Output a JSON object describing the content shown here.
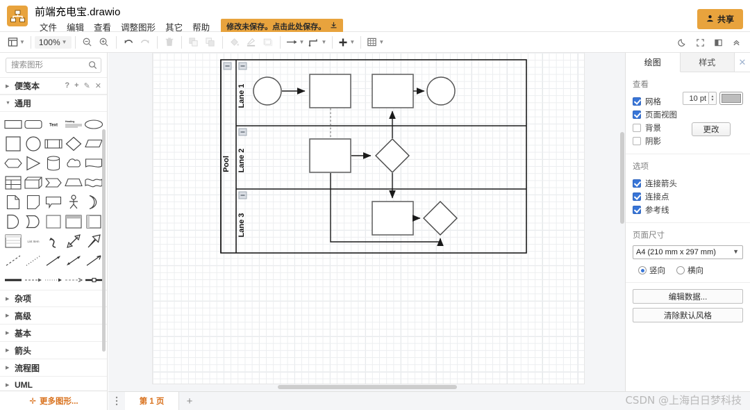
{
  "app": {
    "logo_icon": "drawio-logo-icon",
    "title": "前端充电宝.drawio"
  },
  "menubar": {
    "items": [
      {
        "label": "文件",
        "name": "menu-file"
      },
      {
        "label": "编辑",
        "name": "menu-edit"
      },
      {
        "label": "查看",
        "name": "menu-view"
      },
      {
        "label": "调整图形",
        "name": "menu-arrange"
      },
      {
        "label": "其它",
        "name": "menu-extras"
      },
      {
        "label": "帮助",
        "name": "menu-help"
      }
    ],
    "save_chip": "修改未保存。点击此处保存。",
    "save_chip_icon": "save-icon"
  },
  "share": {
    "label": "共享",
    "icon": "person-icon",
    "color": "#e8a33d"
  },
  "toolbar": {
    "view_icon": "layout-panels-icon",
    "zoom_value": "100%",
    "zoom_out_icon": "zoom-out-icon",
    "zoom_in_icon": "zoom-in-icon",
    "undo_icon": "undo-icon",
    "redo_icon": "redo-icon",
    "delete_icon": "trash-icon",
    "to_front_icon": "bring-to-front-icon",
    "to_back_icon": "send-to-back-icon",
    "fill_icon": "fill-color-icon",
    "line_icon": "line-color-icon",
    "shadow_icon": "shape-style-icon",
    "connection_icon": "connection-arrow-icon",
    "waypoint_icon": "waypoint-icon",
    "insert_icon": "plus-icon",
    "table_icon": "table-icon",
    "right": [
      {
        "icon": "moon-dark-mode-icon",
        "name": "dark-mode-toggle"
      },
      {
        "icon": "fullscreen-icon",
        "name": "fullscreen-button"
      },
      {
        "icon": "format-panel-icon",
        "name": "format-panel-toggle"
      },
      {
        "icon": "collapse-chevrons-icon",
        "name": "collapse-toolbar-button"
      }
    ]
  },
  "sidebar": {
    "search_placeholder": "搜索图形",
    "search_value": "",
    "search_icon": "search-icon",
    "scratchpad": {
      "label": "便笺本",
      "actions": [
        "?",
        "+",
        "✎",
        "✕"
      ]
    },
    "general": {
      "label": "通用",
      "expanded": true
    },
    "sections": [
      {
        "label": "杂项",
        "name": "sidebar-section-misc"
      },
      {
        "label": "高级",
        "name": "sidebar-section-advanced"
      },
      {
        "label": "基本",
        "name": "sidebar-section-basic"
      },
      {
        "label": "箭头",
        "name": "sidebar-section-arrows"
      },
      {
        "label": "流程图",
        "name": "sidebar-section-flowchart"
      },
      {
        "label": "UML",
        "name": "sidebar-section-uml"
      }
    ],
    "more_shapes": "更多图形...",
    "more_shapes_color": "#d9721e"
  },
  "right_panel": {
    "tabs": [
      {
        "label": "绘图",
        "active": true,
        "name": "tab-diagram"
      },
      {
        "label": "样式",
        "active": false,
        "name": "tab-style"
      }
    ],
    "close_icon": "close-icon",
    "view": {
      "title": "查看",
      "grid": {
        "label": "网格",
        "checked": true
      },
      "page_view": {
        "label": "页面视图",
        "checked": true
      },
      "background": {
        "label": "背景",
        "checked": false
      },
      "shadow": {
        "label": "阴影",
        "checked": false
      },
      "grid_size_value": "10 pt",
      "grid_color": "#bdbdbd",
      "change_button": "更改"
    },
    "options": {
      "title": "选项",
      "items": [
        {
          "label": "连接箭头",
          "checked": true,
          "name": "option-connection-arrows"
        },
        {
          "label": "连接点",
          "checked": true,
          "name": "option-connection-points"
        },
        {
          "label": "参考线",
          "checked": true,
          "name": "option-guides"
        }
      ]
    },
    "paper": {
      "title": "页面尺寸",
      "selected": "A4 (210 mm x 297 mm)",
      "orientation": [
        {
          "label": "竖向",
          "selected": true,
          "name": "radio-portrait"
        },
        {
          "label": "横向",
          "selected": false,
          "name": "radio-landscape"
        }
      ]
    },
    "actions": [
      {
        "label": "编辑数据...",
        "name": "edit-data-button"
      },
      {
        "label": "清除默认风格",
        "name": "clear-default-style-button"
      }
    ]
  },
  "bottombar": {
    "menu_icon": "page-menu-icon",
    "page_tab": "第 1 页",
    "add_icon": "+",
    "watermark": "CSDN @上海白日梦科技"
  },
  "diagram": {
    "pool_label": "Pool",
    "lanes": [
      {
        "label": "Lane 1",
        "collapse_icon": "collapse-lane-icon"
      },
      {
        "label": "Lane 2",
        "collapse_icon": "collapse-lane-icon"
      },
      {
        "label": "Lane 3",
        "collapse_icon": "collapse-lane-icon"
      }
    ],
    "pool_collapse_icon": "collapse-pool-icon",
    "shapes": [
      {
        "type": "start-event-circle",
        "lane": "Lane 1",
        "label": ""
      },
      {
        "type": "task-rectangle",
        "lane": "Lane 1",
        "label": ""
      },
      {
        "type": "task-rectangle",
        "lane": "Lane 1",
        "label": ""
      },
      {
        "type": "end-event-circle",
        "lane": "Lane 1",
        "label": ""
      },
      {
        "type": "task-rectangle",
        "lane": "Lane 2",
        "label": ""
      },
      {
        "type": "gateway-diamond",
        "lane": "Lane 2",
        "label": ""
      },
      {
        "type": "task-rectangle",
        "lane": "Lane 3",
        "label": ""
      },
      {
        "type": "gateway-diamond",
        "lane": "Lane 3",
        "label": ""
      }
    ]
  }
}
